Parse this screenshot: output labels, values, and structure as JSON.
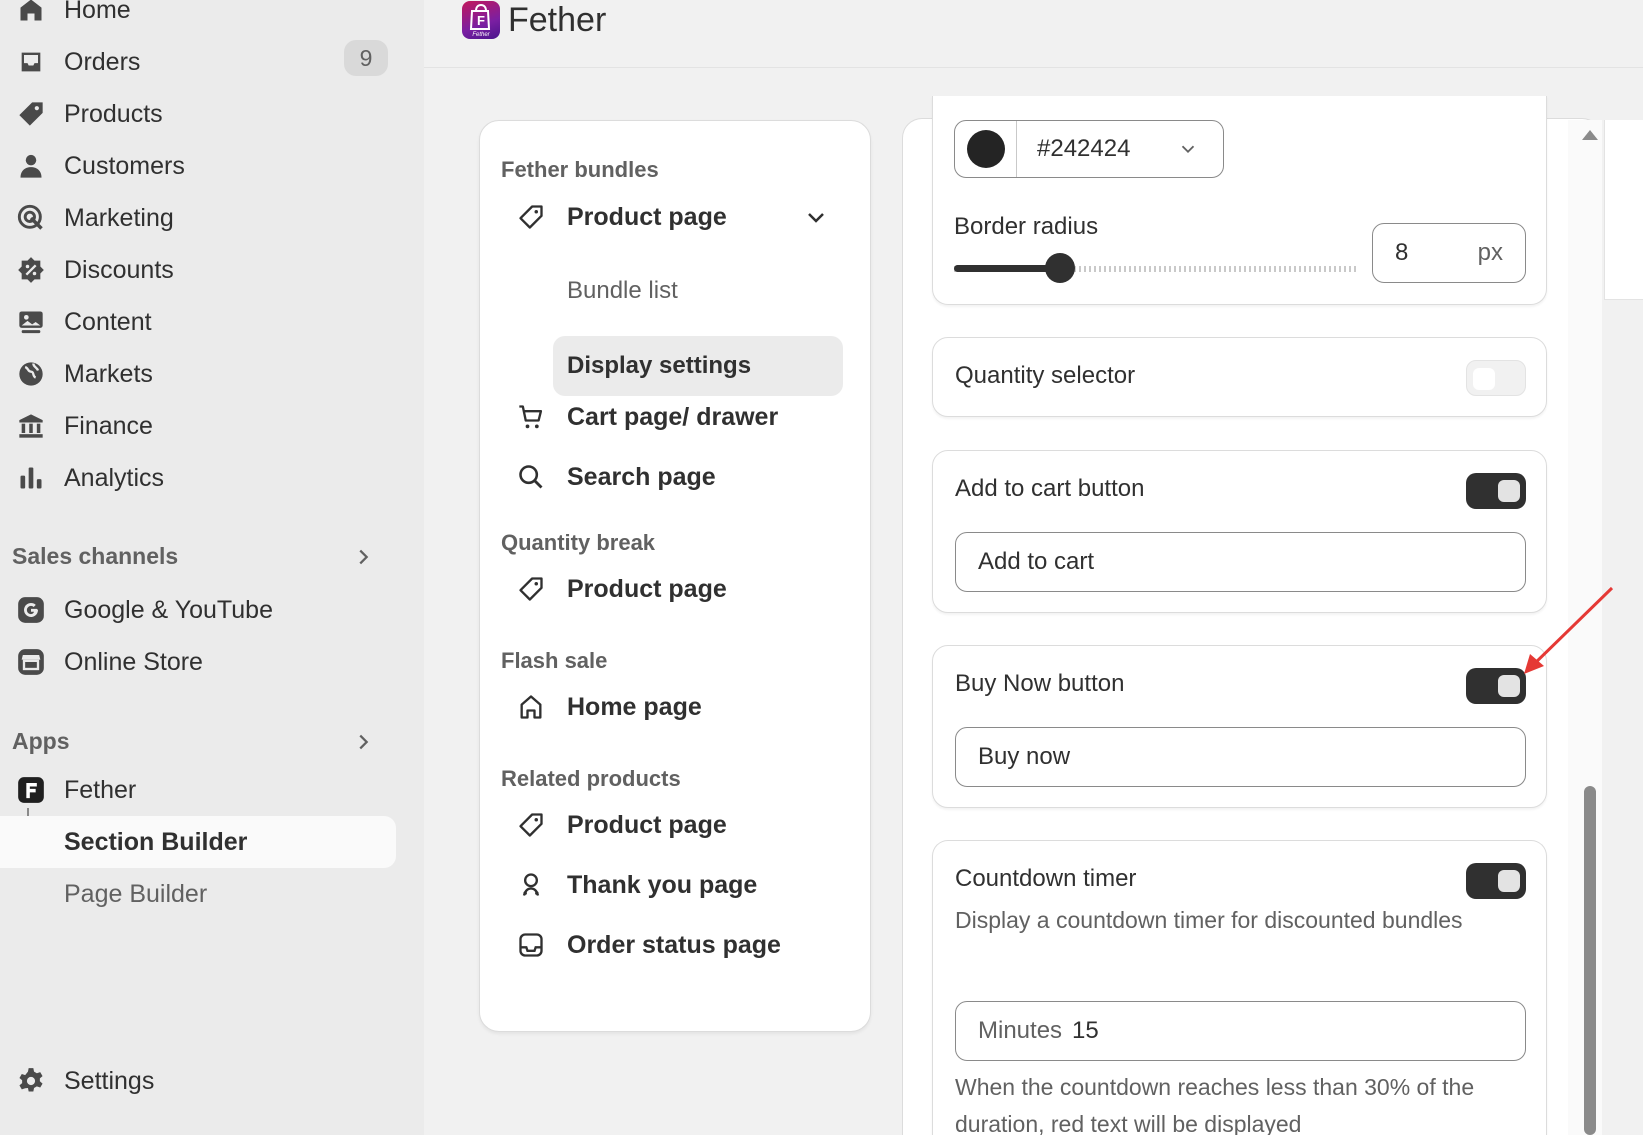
{
  "sidebar": {
    "items": [
      {
        "label": "Home",
        "icon": "home-icon"
      },
      {
        "label": "Orders",
        "icon": "orders-icon",
        "badge": "9"
      },
      {
        "label": "Products",
        "icon": "tag-icon"
      },
      {
        "label": "Customers",
        "icon": "person-icon"
      },
      {
        "label": "Marketing",
        "icon": "target-icon"
      },
      {
        "label": "Discounts",
        "icon": "discount-icon"
      },
      {
        "label": "Content",
        "icon": "content-icon"
      },
      {
        "label": "Markets",
        "icon": "globe-icon"
      },
      {
        "label": "Finance",
        "icon": "bank-icon"
      },
      {
        "label": "Analytics",
        "icon": "bar-chart-icon"
      }
    ],
    "sales_channels_label": "Sales channels",
    "channels": [
      {
        "label": "Google & YouTube",
        "icon": "google-icon"
      },
      {
        "label": "Online Store",
        "icon": "store-icon"
      }
    ],
    "apps_label": "Apps",
    "app": {
      "label": "Fether",
      "icon": "fether-app-icon"
    },
    "app_subitems": [
      {
        "label": "Section Builder",
        "active": true
      },
      {
        "label": "Page Builder",
        "active": false
      }
    ],
    "settings_label": "Settings"
  },
  "header": {
    "app_name": "Fether",
    "logo_letter": "F",
    "logo_caption": "Fether"
  },
  "nav_card": {
    "groups": [
      {
        "title": "Fether bundles",
        "items": [
          {
            "label": "Product page",
            "icon": "tag-icon",
            "expanded": true
          },
          {
            "label": "Cart page/ drawer",
            "icon": "cart-icon"
          },
          {
            "label": "Search page",
            "icon": "search-icon"
          }
        ],
        "subitems": [
          {
            "label": "Bundle list"
          },
          {
            "label": "Display settings",
            "active": true
          }
        ]
      },
      {
        "title": "Quantity break",
        "items": [
          {
            "label": "Product page",
            "icon": "tag-icon"
          }
        ]
      },
      {
        "title": "Flash sale",
        "items": [
          {
            "label": "Home page",
            "icon": "home-icon"
          }
        ]
      },
      {
        "title": "Related products",
        "items": [
          {
            "label": "Product page",
            "icon": "tag-icon"
          },
          {
            "label": "Thank you page",
            "icon": "thank-you-icon"
          },
          {
            "label": "Order status page",
            "icon": "inbox-icon"
          }
        ]
      }
    ]
  },
  "settings": {
    "color_value": "#242424",
    "swatch_color": "#242424",
    "border_radius_label": "Border radius",
    "border_radius_value": "8",
    "border_radius_unit": "px",
    "quantity_selector_label": "Quantity selector",
    "quantity_selector_on": false,
    "add_to_cart_label": "Add to cart button",
    "add_to_cart_on": true,
    "add_to_cart_text": "Add to cart",
    "buy_now_label": "Buy Now button",
    "buy_now_on": true,
    "buy_now_text": "Buy now",
    "countdown_label": "Countdown timer",
    "countdown_on": true,
    "countdown_desc": "Display a countdown timer for discounted bundles",
    "minutes_prefix": "Minutes",
    "minutes_value": "15",
    "countdown_help": "When the countdown reaches less than 30% of the duration, red text will be displayed"
  },
  "colors": {
    "accent": "#303030",
    "annotation_arrow": "#e53935",
    "background": "#f1f1f1"
  }
}
